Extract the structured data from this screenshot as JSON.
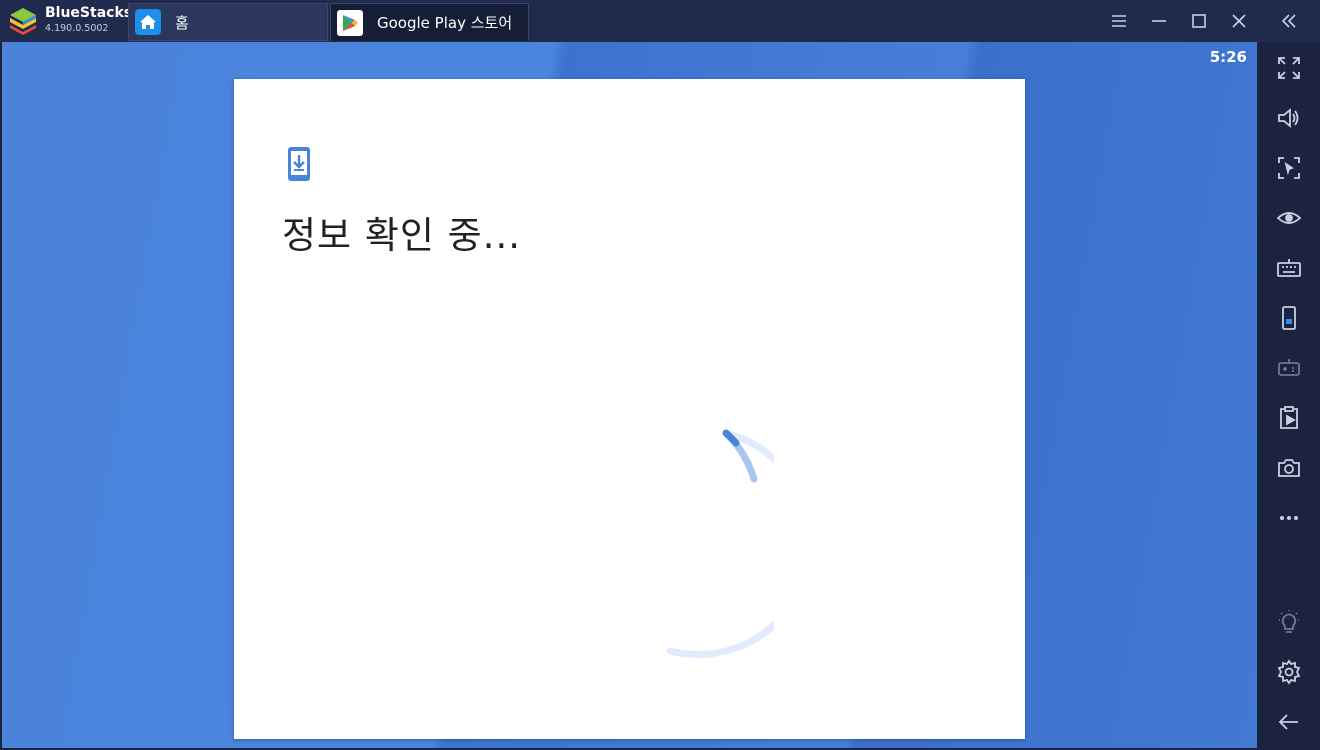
{
  "app": {
    "name": "BlueStacks",
    "version": "4.190.0.5002"
  },
  "tabs": [
    {
      "label": "홈",
      "icon": "home-icon"
    },
    {
      "label": "Google Play 스토어",
      "icon": "google-play-icon"
    }
  ],
  "window_controls": [
    "menu-icon",
    "minimize-icon",
    "maximize-icon",
    "close-icon",
    "collapse-sidebar-icon"
  ],
  "status_bar": {
    "time": "5:26"
  },
  "dialog": {
    "icon": "phone-download-icon",
    "title": "정보 확인 중..."
  },
  "sidebar": {
    "items": [
      "fullscreen-icon",
      "volume-icon",
      "pointer-lock-icon",
      "eye-icon",
      "keyboard-icon",
      "phone-rotate-icon",
      "gamepad-icon",
      "multi-instance-icon",
      "camera-icon",
      "more-icon",
      "lightbulb-icon",
      "settings-icon",
      "back-arrow-icon"
    ]
  },
  "colors": {
    "titlebar": "#1f2a4d",
    "android_bg": "#4a86de",
    "accent": "#4285f4",
    "dialog_bg": "#ffffff"
  }
}
